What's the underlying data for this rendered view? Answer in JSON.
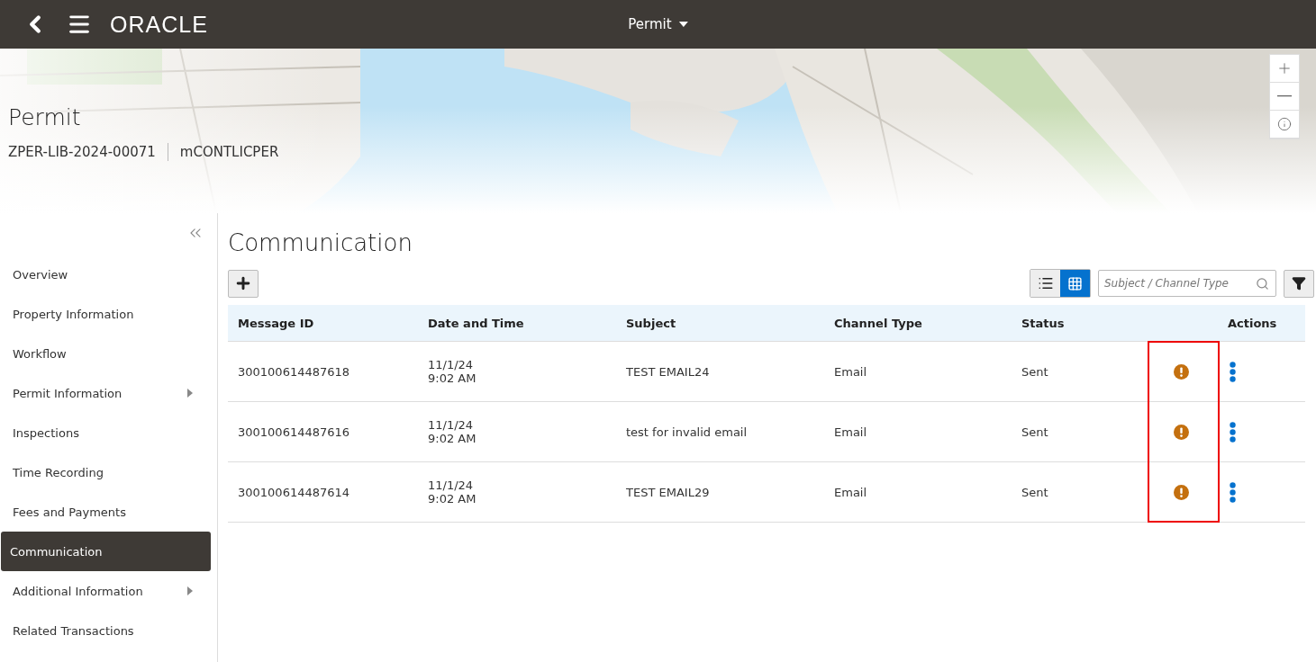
{
  "top_bar": {
    "logo": "ORACLE",
    "title": "Permit"
  },
  "banner": {
    "title": "Permit",
    "record_id": "ZPER-LIB-2024-00071",
    "record_type": "mCONTLICPER"
  },
  "sidebar": {
    "items": [
      {
        "label": "Overview",
        "selected": false,
        "expandable": false
      },
      {
        "label": "Property Information",
        "selected": false,
        "expandable": false
      },
      {
        "label": "Workflow",
        "selected": false,
        "expandable": false
      },
      {
        "label": "Permit Information",
        "selected": false,
        "expandable": true
      },
      {
        "label": "Inspections",
        "selected": false,
        "expandable": false
      },
      {
        "label": "Time Recording",
        "selected": false,
        "expandable": false
      },
      {
        "label": "Fees and Payments",
        "selected": false,
        "expandable": false
      },
      {
        "label": "Communication",
        "selected": true,
        "expandable": false
      },
      {
        "label": "Additional Information",
        "selected": false,
        "expandable": true
      },
      {
        "label": "Related Transactions",
        "selected": false,
        "expandable": false
      }
    ]
  },
  "page_title": "Communication",
  "toolbar": {
    "views": [
      {
        "kind": "list",
        "selected": false
      },
      {
        "kind": "table",
        "selected": true
      }
    ],
    "search": {
      "placeholder": "Subject / Channel Type"
    }
  },
  "table": {
    "columns": [
      "Message ID",
      "Date and Time",
      "Subject",
      "Channel Type",
      "Status",
      "",
      "Actions"
    ],
    "rows": [
      {
        "message_id": "300100614487618",
        "date": "11/1/24",
        "time": "9:02 AM",
        "subject": "TEST EMAIL24",
        "channel_type": "Email",
        "status": "Sent",
        "warning": true
      },
      {
        "message_id": "300100614487616",
        "date": "11/1/24",
        "time": "9:02 AM",
        "subject": "test for invalid email",
        "channel_type": "Email",
        "status": "Sent",
        "warning": true
      },
      {
        "message_id": "300100614487614",
        "date": "11/1/24",
        "time": "9:02 AM",
        "subject": "TEST EMAIL29",
        "channel_type": "Email",
        "status": "Sent",
        "warning": true
      }
    ]
  }
}
